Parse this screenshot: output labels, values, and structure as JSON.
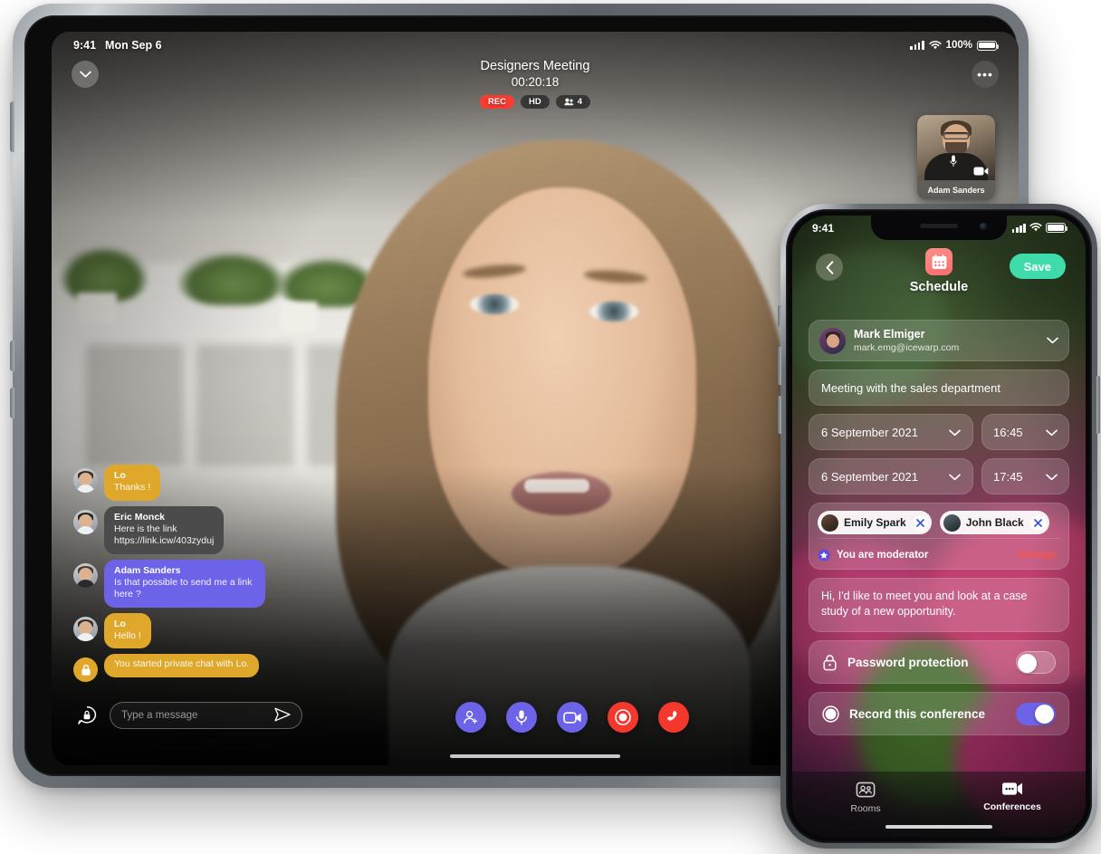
{
  "tablet": {
    "status_bar": {
      "time": "9:41",
      "date": "Mon Sep 6",
      "battery_percent": "100%"
    },
    "call": {
      "title": "Designers Meeting",
      "timer": "00:20:18",
      "badge_rec": "REC",
      "badge_quality": "HD",
      "badge_participants": "4"
    },
    "self_view": {
      "name": "Adam Sanders"
    },
    "chat": [
      {
        "name": "Lo",
        "text": "Thanks !",
        "style": "yellow"
      },
      {
        "name": "Eric Monck",
        "text": "Here is the link\nhttps://link.icw/403zyduj",
        "style": "dark"
      },
      {
        "name": "Adam Sanders",
        "text": "Is that possible to send me a link here ?",
        "style": "purple"
      },
      {
        "name": "Lo",
        "text": "Hello !",
        "style": "yellow"
      },
      {
        "name": "",
        "text": "You started private chat with Lo.",
        "style": "yellow"
      }
    ],
    "composer": {
      "placeholder": "Type a message"
    },
    "actions": [
      {
        "name": "add-participant",
        "color": "#6c63e8"
      },
      {
        "name": "microphone",
        "color": "#6c63e8"
      },
      {
        "name": "camera",
        "color": "#6c63e8"
      },
      {
        "name": "stop-recording",
        "color": "#f5382e"
      },
      {
        "name": "end-call",
        "color": "#f5382e"
      }
    ]
  },
  "phone": {
    "status_bar": {
      "time": "9:41"
    },
    "nav": {
      "save_label": "Save",
      "page_title": "Schedule"
    },
    "organizer": {
      "name": "Mark Elmiger",
      "email": "mark.emg@icewarp.com"
    },
    "subject": "Meeting with the sales department",
    "start": {
      "date": "6 September 2021",
      "time": "16:45"
    },
    "end": {
      "date": "6 September 2021",
      "time": "17:45"
    },
    "participants": [
      {
        "name": "Emily Spark"
      },
      {
        "name": "John Black"
      }
    ],
    "moderator": {
      "text": "You are moderator",
      "action": "Manage",
      "action_color": "#f2574f"
    },
    "note": "Hi, I'd like to meet you and look at a case study of a new opportunity.",
    "toggles": [
      {
        "label": "Password protection",
        "state": "off",
        "icon": "lock-icon"
      },
      {
        "label": "Record this conference",
        "state": "on",
        "icon": "record-icon"
      }
    ],
    "tabs": [
      {
        "label": "Rooms",
        "icon": "rooms-icon",
        "active": false
      },
      {
        "label": "Conferences",
        "icon": "conferences-icon",
        "active": true
      }
    ]
  },
  "colors": {
    "accent_purple": "#6c63e8",
    "accent_red": "#f5382e",
    "accent_yellow": "#e0a82a",
    "accent_green": "#3ddcaa",
    "badge_rec": "#ff3b30"
  }
}
